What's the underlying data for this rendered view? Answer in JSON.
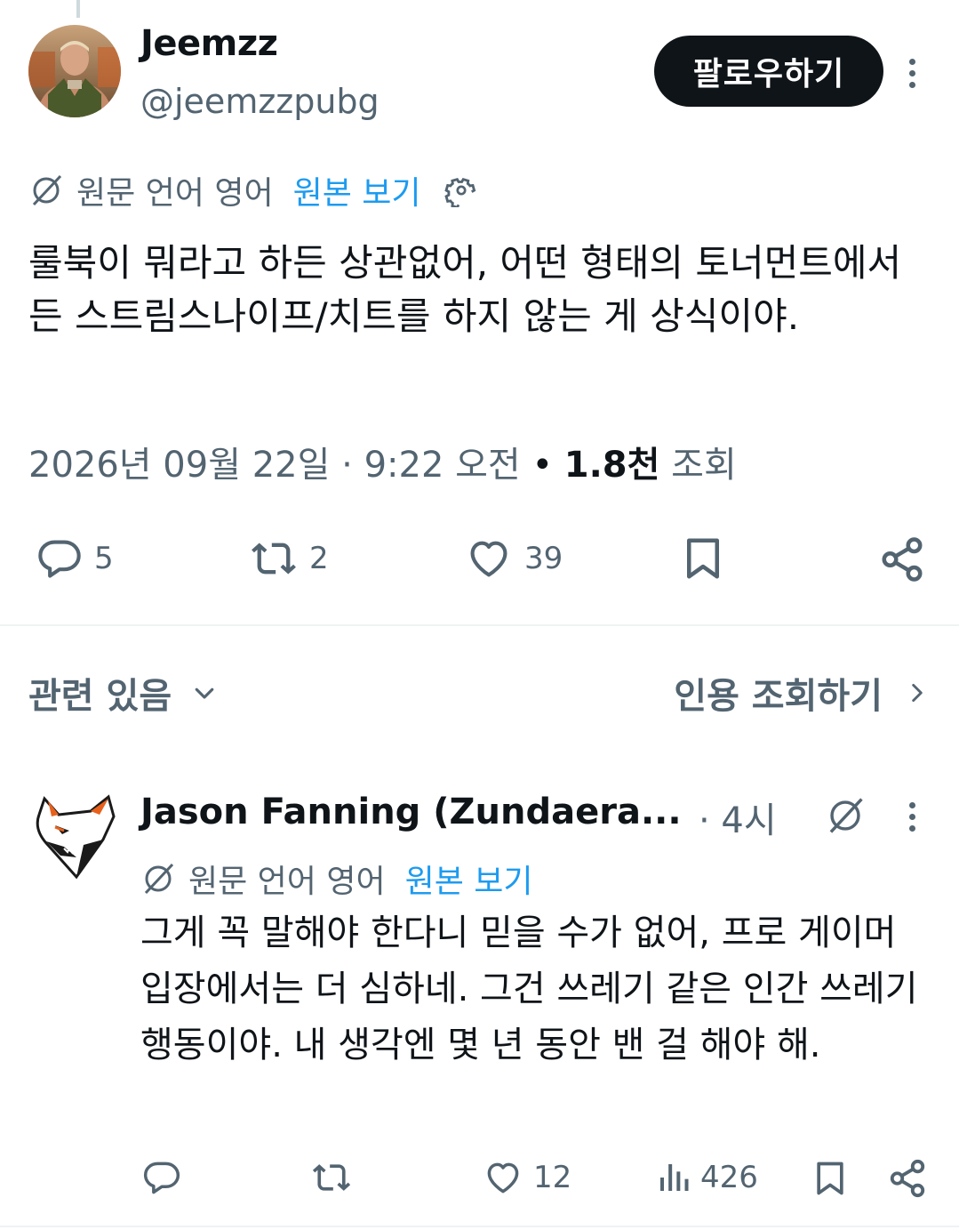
{
  "tweet": {
    "author_name": "Jeemzz",
    "author_handle": "@jeemzzpubg",
    "follow_label": "팔로우하기",
    "translation": {
      "lang_label": "원문 언어 영어",
      "view_original": "원본 보기"
    },
    "text": "룰북이 뭐라고 하든 상관없어, 어떤 형태의 토너먼트에서든 스트림스나이프/치트를 하지 않는 게 상식이야.",
    "date": "2026년 09월 22일",
    "time": "9:22 오전",
    "views_count": "1.8천",
    "views_label": "조회",
    "actions": {
      "replies": "5",
      "reposts": "2",
      "likes": "39"
    }
  },
  "related": {
    "title": "관련 있음",
    "quote_link": "인용 조회하기"
  },
  "reply": {
    "author_name": "Jason Fanning (Zundaera...",
    "time": "· 4시",
    "translation": {
      "lang_label": "원문 언어 영어",
      "view_original": "원본 보기"
    },
    "text": "그게 꼭 말해야 한다니 믿을 수가 없어, 프로 게이머 입장에서는 더 심하네. 그건 쓰레기 같은 인간 쓰레기 행동이야. 내 생각엔 몇 년 동안 밴 걸 해야 해.",
    "actions": {
      "likes": "12",
      "views": "426"
    }
  },
  "colors": {
    "text_primary": "#0f1419",
    "text_secondary": "#536471",
    "link": "#1d9bf0",
    "divider": "#eff3f4",
    "follow_bg": "#0f1419"
  },
  "icons": [
    "translate-icon",
    "gear-icon",
    "reply-icon",
    "repost-icon",
    "like-icon",
    "bookmark-icon",
    "share-icon",
    "chevron-down-icon",
    "chevron-right-icon",
    "more-icon",
    "grok-icon",
    "views-icon"
  ]
}
